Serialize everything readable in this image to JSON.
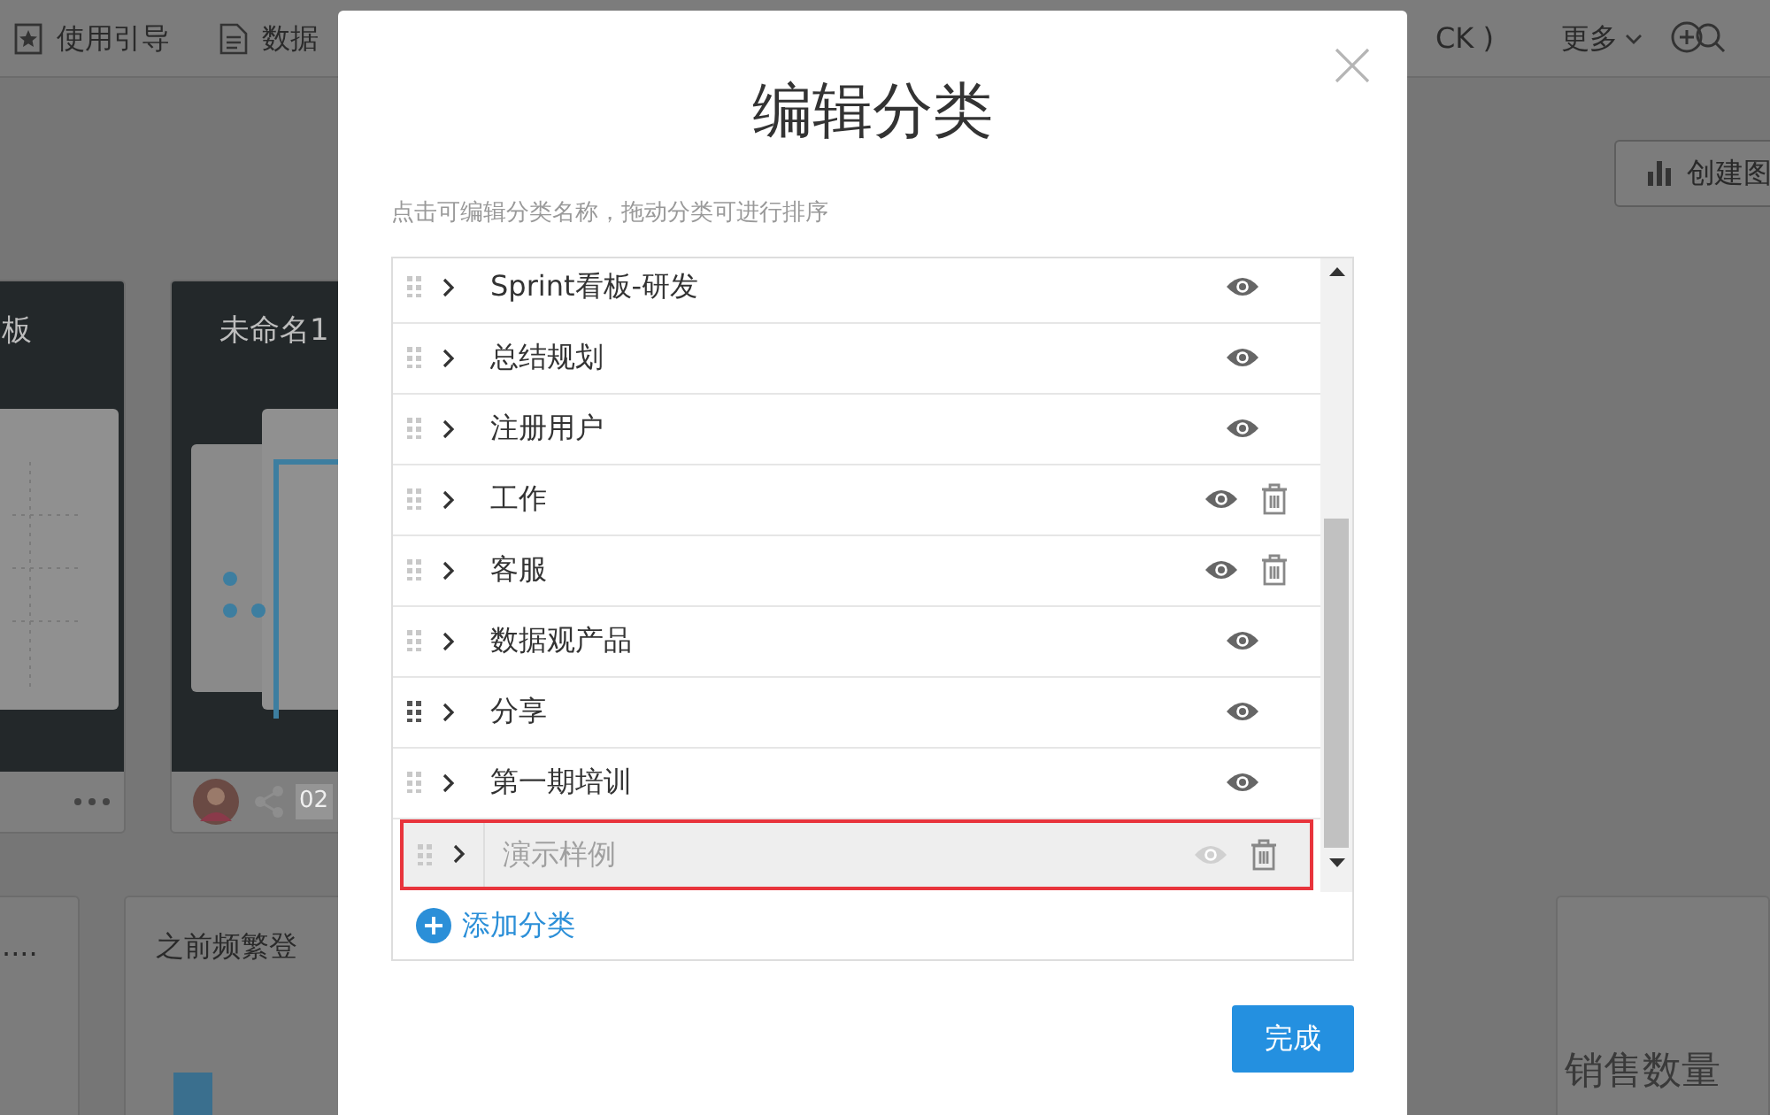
{
  "topbar": {
    "items": [
      {
        "label": "使用引导",
        "kind": "guide"
      },
      {
        "label": "数据",
        "kind": "doc"
      }
    ],
    "partial_text": "CK )",
    "more": "更多"
  },
  "create_button": "创建图",
  "cards": [
    {
      "title": "板",
      "kind": "menu"
    },
    {
      "title": "未命名1",
      "kind": "owner",
      "date": "02"
    }
  ],
  "lower_cards": [
    {
      "title": "...."
    },
    {
      "title": "之前频繁登"
    },
    {
      "title": "销售数量"
    }
  ],
  "dialog": {
    "title": "编辑分类",
    "hint": "点击可编辑分类名称，拖动分类可进行排序",
    "categories": [
      {
        "name": "Sprint看板-研发",
        "visible": true,
        "deletable": false,
        "selected": false,
        "hovered": false
      },
      {
        "name": "总结规划",
        "visible": true,
        "deletable": false,
        "selected": false,
        "hovered": false
      },
      {
        "name": "注册用户",
        "visible": true,
        "deletable": false,
        "selected": false,
        "hovered": false
      },
      {
        "name": "工作",
        "visible": true,
        "deletable": true,
        "selected": false,
        "hovered": false
      },
      {
        "name": "客服",
        "visible": true,
        "deletable": true,
        "selected": false,
        "hovered": false
      },
      {
        "name": "数据观产品",
        "visible": true,
        "deletable": false,
        "selected": false,
        "hovered": false
      },
      {
        "name": "分享",
        "visible": true,
        "deletable": false,
        "selected": false,
        "hovered": true
      },
      {
        "name": "第一期培训",
        "visible": true,
        "deletable": false,
        "selected": false,
        "hovered": false
      },
      {
        "name": "演示样例",
        "visible": false,
        "deletable": true,
        "selected": true,
        "hovered": false
      }
    ],
    "add_label": "添加分类",
    "done": "完成"
  }
}
